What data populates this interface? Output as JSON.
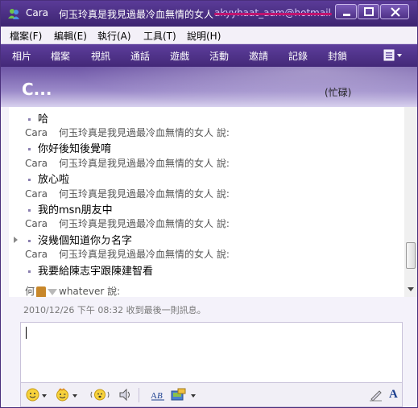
{
  "window": {
    "title_name": "Cara",
    "title_sub": "何玉玲真是我見過最冷血無情的女人",
    "title_email": "akyyhaat_aam@hotmail..."
  },
  "menu": [
    {
      "label": "檔案(F)"
    },
    {
      "label": "編輯(E)"
    },
    {
      "label": "執行(A)"
    },
    {
      "label": "工具(T)"
    },
    {
      "label": "說明(H)"
    }
  ],
  "toolbar": [
    {
      "label": "相片"
    },
    {
      "label": "檔案"
    },
    {
      "label": "視訊"
    },
    {
      "label": "通話"
    },
    {
      "label": "遊戲"
    },
    {
      "label": "活動"
    },
    {
      "label": "邀請"
    },
    {
      "label": "記錄"
    },
    {
      "label": "封鎖"
    }
  ],
  "contact": {
    "name": "C...",
    "status": "(忙碌)"
  },
  "conversation": {
    "sender_name": "Cara",
    "sender_nick": "何玉玲真是我見過最冷血無情的女人 說:",
    "messages": [
      {
        "text": "哈"
      },
      {
        "text": "你好後知後覺唷"
      },
      {
        "text": "放心啦"
      },
      {
        "text": "我的msn朋友中"
      },
      {
        "text": "沒幾個知道你ㄉ名字"
      },
      {
        "text": "我要給陳志宇跟陳建智看"
      }
    ],
    "typing_prefix": "何",
    "typing_suffix": "whatever 說:"
  },
  "status_bar": {
    "last_message": "2010/12/26 下午 08:32 收到最後一則訊息。"
  },
  "bottom_toolbar": {
    "font_label": "A"
  },
  "colors": {
    "titlebar": "#4b2f86",
    "toolbar": "#51348c",
    "accent_strike": "#c0146e"
  }
}
